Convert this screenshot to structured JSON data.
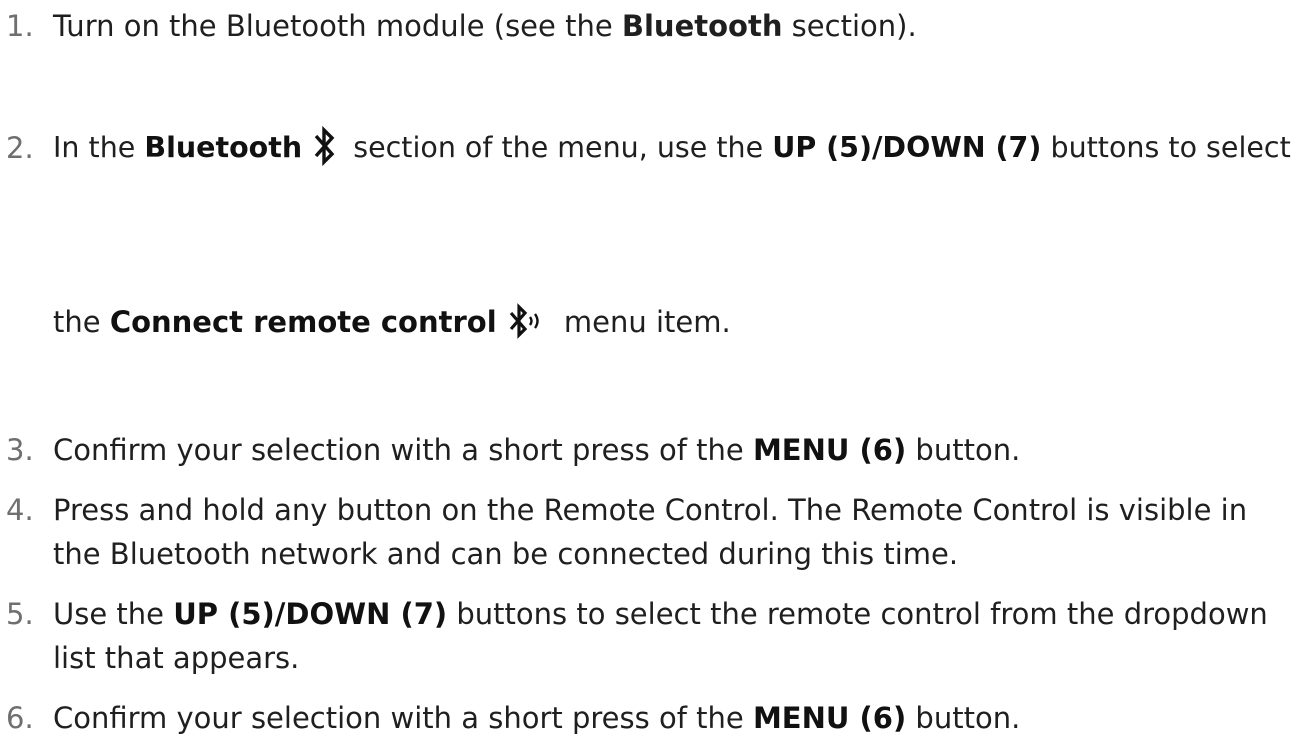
{
  "steps": [
    {
      "number": "1.",
      "lines": [
        {
          "t1": "Turn on the Bluetooth module (see the ",
          "b1": "Bluetooth",
          "t2": " section)."
        }
      ]
    },
    {
      "number": "2.",
      "lines": [
        {
          "t1": "In the ",
          "b1": "Bluetooth",
          "icon": "bluetooth-icon",
          "t2": " section of the menu, use the ",
          "b2": "UP (5)/DOWN (7)",
          "t3": " buttons to select"
        },
        {
          "t1": "the ",
          "b1": "Connect remote control",
          "icon": "bluetooth-connect-icon",
          "t2": " menu item."
        }
      ]
    },
    {
      "number": "3.",
      "lines": [
        {
          "t1": "Confirm your selection with a short press of the ",
          "b1": "MENU (6)",
          "t2": " button."
        }
      ]
    },
    {
      "number": "4.",
      "lines": [
        {
          "t1": "Press and hold any button on the Remote Control. The Remote Control is visible in"
        },
        {
          "t1": "the Bluetooth network and can be connected during this time."
        }
      ]
    },
    {
      "number": "5.",
      "lines": [
        {
          "t1": "Use the ",
          "b1": "UP (5)/DOWN (7)",
          "t2": " buttons to select the remote control from the dropdown"
        },
        {
          "t1": "list that appears."
        }
      ]
    },
    {
      "number": "6.",
      "lines": [
        {
          "t1": "Confirm your selection with a short press of the ",
          "b1": "MENU (6)",
          "t2": " button."
        }
      ]
    }
  ]
}
